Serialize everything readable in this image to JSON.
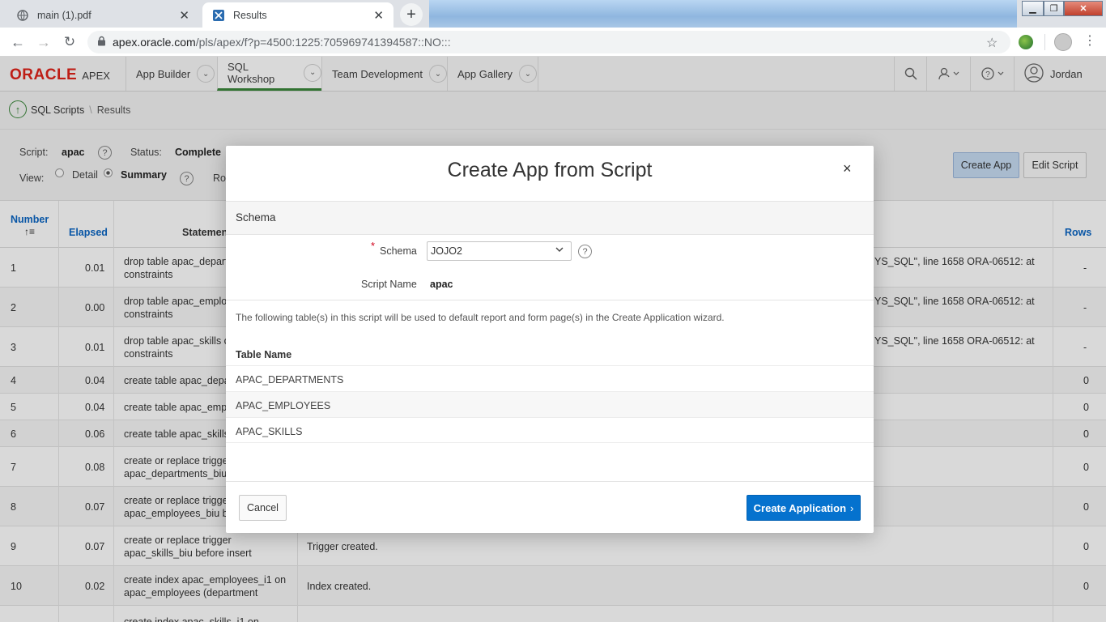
{
  "browser": {
    "tabs": [
      {
        "title": "main (1).pdf"
      },
      {
        "title": "Results"
      }
    ],
    "url_host": "apex.oracle.com",
    "url_path": "/pls/apex/f?p=4500:1225:705969741394587::NO:::"
  },
  "apex": {
    "logo_brand": "ORACLE",
    "logo_product": "APEX",
    "nav_tabs": [
      "App Builder",
      "SQL Workshop",
      "Team Development",
      "App Gallery"
    ],
    "user": "Jordan"
  },
  "breadcrumb": {
    "parent": "SQL Scripts",
    "current": "Results"
  },
  "info": {
    "script_label": "Script:",
    "script_value": "apac",
    "status_label": "Status:",
    "status_value": "Complete",
    "view_label": "View:",
    "view_options": [
      "Detail",
      "Summary"
    ],
    "view_selected": "Summary",
    "rows_label_partial": "Ro",
    "create_app_button": "Create App",
    "edit_script_button": "Edit Script"
  },
  "table": {
    "headers": {
      "number": "Number",
      "elapsed": "Elapsed",
      "statement": "Statemen",
      "rows": "Rows"
    },
    "rows": [
      {
        "number": "1",
        "elapsed": "0.01",
        "stmt1": "drop table apac_departr",
        "stmt2": "constraints",
        "feedback": "YS_SQL\", line 1658 ORA-06512: at",
        "rows": "-"
      },
      {
        "number": "2",
        "elapsed": "0.00",
        "stmt1": "drop table apac_employ",
        "stmt2": "constraints",
        "feedback": "YS_SQL\", line 1658 ORA-06512: at",
        "rows": "-"
      },
      {
        "number": "3",
        "elapsed": "0.01",
        "stmt1": "drop table apac_skills ca",
        "stmt2": "constraints",
        "feedback": "YS_SQL\", line 1658 ORA-06512: at",
        "rows": "-"
      },
      {
        "number": "4",
        "elapsed": "0.04",
        "stmt1": "create table apac_depar",
        "stmt2": "",
        "feedback": "",
        "rows": "0"
      },
      {
        "number": "5",
        "elapsed": "0.04",
        "stmt1": "create table apac_emplo",
        "stmt2": "",
        "feedback": "",
        "rows": "0"
      },
      {
        "number": "6",
        "elapsed": "0.06",
        "stmt1": "create table apac_skills (",
        "stmt2": "",
        "feedback": "",
        "rows": "0"
      },
      {
        "number": "7",
        "elapsed": "0.08",
        "stmt1": "create or replace trigger",
        "stmt2": "apac_departments_biu b",
        "feedback": "",
        "rows": "0"
      },
      {
        "number": "8",
        "elapsed": "0.07",
        "stmt1": "create or replace trigger",
        "stmt2": "apac_employees_biu be",
        "feedback": "",
        "rows": "0"
      },
      {
        "number": "9",
        "elapsed": "0.07",
        "stmt1": "create or replace trigger",
        "stmt2": "apac_skills_biu before insert",
        "feedback": "Trigger created.",
        "rows": "0"
      },
      {
        "number": "10",
        "elapsed": "0.02",
        "stmt1": "create index apac_employees_i1 on",
        "stmt2": "apac_employees (department",
        "feedback": "Index created.",
        "rows": "0"
      },
      {
        "number": "",
        "elapsed": "",
        "stmt1": "create index apac_skills_i1 on",
        "stmt2": "",
        "feedback": "",
        "rows": ""
      }
    ]
  },
  "modal": {
    "title": "Create App from Script",
    "close_glyph": "×",
    "section_title": "Schema",
    "schema_label": "Schema",
    "required_mark": "*",
    "schema_value": "JOJO2",
    "script_name_label": "Script Name",
    "script_name_value": "apac",
    "description": "The following table(s) in this script will be used to default report and form page(s) in the Create Application wizard.",
    "table_name_header": "Table Name",
    "tables": [
      "APAC_DEPARTMENTS",
      "APAC_EMPLOYEES",
      "APAC_SKILLS"
    ],
    "cancel_button": "Cancel",
    "create_button": "Create Application"
  },
  "colors": {
    "accent_blue": "#0572ce",
    "oracle_red": "#e0241b",
    "nav_selected_green": "#3a873a"
  }
}
